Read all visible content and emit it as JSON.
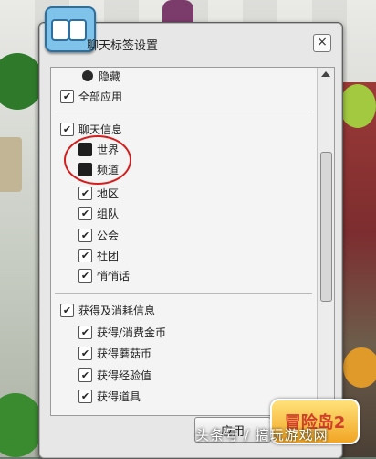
{
  "dialog": {
    "title": "聊天标签设置",
    "close_label": "×"
  },
  "list": {
    "hidden_label": "隐藏",
    "all_apply_label": "全部应用",
    "chat_group": {
      "label": "聊天信息",
      "items": [
        {
          "label": "世界",
          "checked": false
        },
        {
          "label": "频道",
          "checked": false
        },
        {
          "label": "地区",
          "checked": true
        },
        {
          "label": "组队",
          "checked": true
        },
        {
          "label": "公会",
          "checked": true
        },
        {
          "label": "社团",
          "checked": true
        },
        {
          "label": "悄悄话",
          "checked": true
        }
      ]
    },
    "acquire_group": {
      "label": "获得及消耗信息",
      "items": [
        {
          "label": "获得/消费金币",
          "checked": true
        },
        {
          "label": "获得蘑菇币",
          "checked": true
        },
        {
          "label": "获得经验值",
          "checked": true
        },
        {
          "label": "获得道具",
          "checked": true
        }
      ]
    }
  },
  "buttons": {
    "apply_label": "应用"
  },
  "overlay": {
    "watermark_text": "头条号 / 搞玩游戏网",
    "logo_text": "冒险岛2"
  },
  "colors": {
    "highlight_circle": "#d41e1e",
    "dialog_bg": "#e7e7e7"
  }
}
